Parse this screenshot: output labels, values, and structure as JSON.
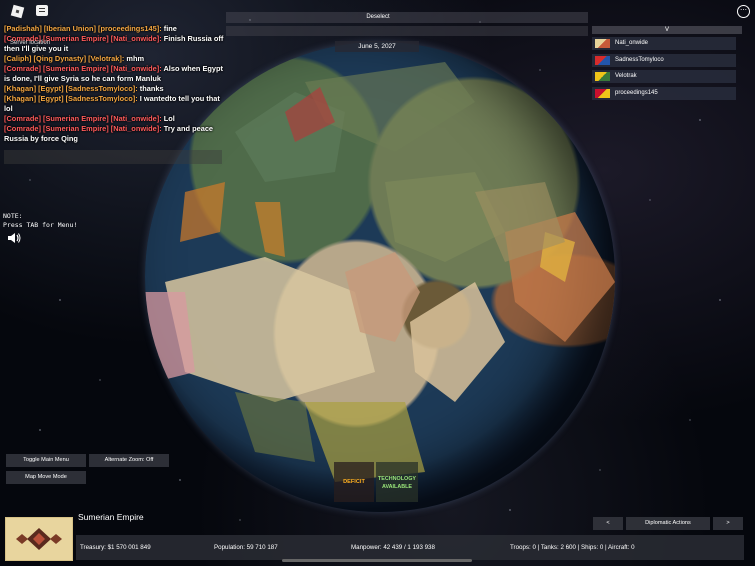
{
  "chat": {
    "lines": [
      {
        "parts": [
          {
            "t": "[Padishah] [Iberian Union] [proceedings145]:",
            "c": "tag"
          },
          {
            "t": " fine",
            "c": ""
          }
        ]
      },
      {
        "parts": [
          {
            "t": "[Comrade] [Sumerian Empire] [Nati_onwide]:",
            "c": "tag-red"
          },
          {
            "t": " Finish Russia off then I'll give you it",
            "c": ""
          }
        ]
      },
      {
        "parts": [
          {
            "t": "[Caliph] [Qing Dynasty] [Velotrak]:",
            "c": "tag"
          },
          {
            "t": " mhm",
            "c": ""
          }
        ]
      },
      {
        "parts": [
          {
            "t": "[Comrade] [Sumerian Empire] [Nati_onwide]:",
            "c": "tag-red"
          },
          {
            "t": " Also when Egypt is done, I'll give Syria so he can form Manluk",
            "c": ""
          }
        ]
      },
      {
        "parts": [
          {
            "t": "[Khagan] [Egypt] [SadnessTomyloco]:",
            "c": "tag"
          },
          {
            "t": " thanks",
            "c": ""
          }
        ]
      },
      {
        "parts": [
          {
            "t": "[Khagan] [Egypt] [SadnessTomyloco]:",
            "c": "tag"
          },
          {
            "t": " I wantedto tell you that lol",
            "c": ""
          }
        ]
      },
      {
        "parts": [
          {
            "t": "[Comrade] [Sumerian Empire] [Nati_onwide]:",
            "c": "tag-red"
          },
          {
            "t": " Lol",
            "c": ""
          }
        ]
      },
      {
        "parts": [
          {
            "t": "[Comrade] [Sumerian Empire] [Nati_onwide]:",
            "c": "tag-red"
          },
          {
            "t": " Try and peace Russia by force Qing",
            "c": ""
          }
        ]
      }
    ],
    "server_label": "Server location"
  },
  "note": {
    "line1": "NOTE:",
    "line2": "Press TAB for Menu!"
  },
  "topbar": {
    "deselect": "Deselect",
    "date": "June 5, 2027"
  },
  "players": {
    "header": "V",
    "list": [
      {
        "name": "Nati_onwide",
        "flag_colors": [
          "#e6d39a",
          "#c65a3a"
        ]
      },
      {
        "name": "SadnessTomyloco",
        "flag_colors": [
          "#d62c2c",
          "#2255aa"
        ]
      },
      {
        "name": "Velotrak",
        "flag_colors": [
          "#f0c419",
          "#3a7a3a"
        ]
      },
      {
        "name": "proceedings145",
        "flag_colors": [
          "#c8102e",
          "#f0c419"
        ]
      }
    ]
  },
  "buttons": {
    "toggle_main_menu": "Toggle Main Menu",
    "alternate_zoom": "Alternate Zoom: Off",
    "map_move_mode": "Map Move Mode",
    "prev": "<",
    "diplomatic_actions": "Diplomatic Actions",
    "next": ">"
  },
  "alerts": {
    "deficit": "DEFICIT",
    "technology_line1": "TECHNOLOGY",
    "technology_line2": "AVAILABLE"
  },
  "country": {
    "name": "Sumerian Empire",
    "treasury": "Treasury:  $1 570 001 849",
    "population": "Population: 59 710 187",
    "manpower": "Manpower:  42 439  /  1 193 938",
    "military": "Troops: 0  |  Tanks: 2 600  |  Ships: 0  |  Aircraft: 0"
  },
  "colors": {
    "chat_tag": "#f4a640",
    "chat_tag_red": "#ff5a5a",
    "panel": "#2a2c34"
  }
}
